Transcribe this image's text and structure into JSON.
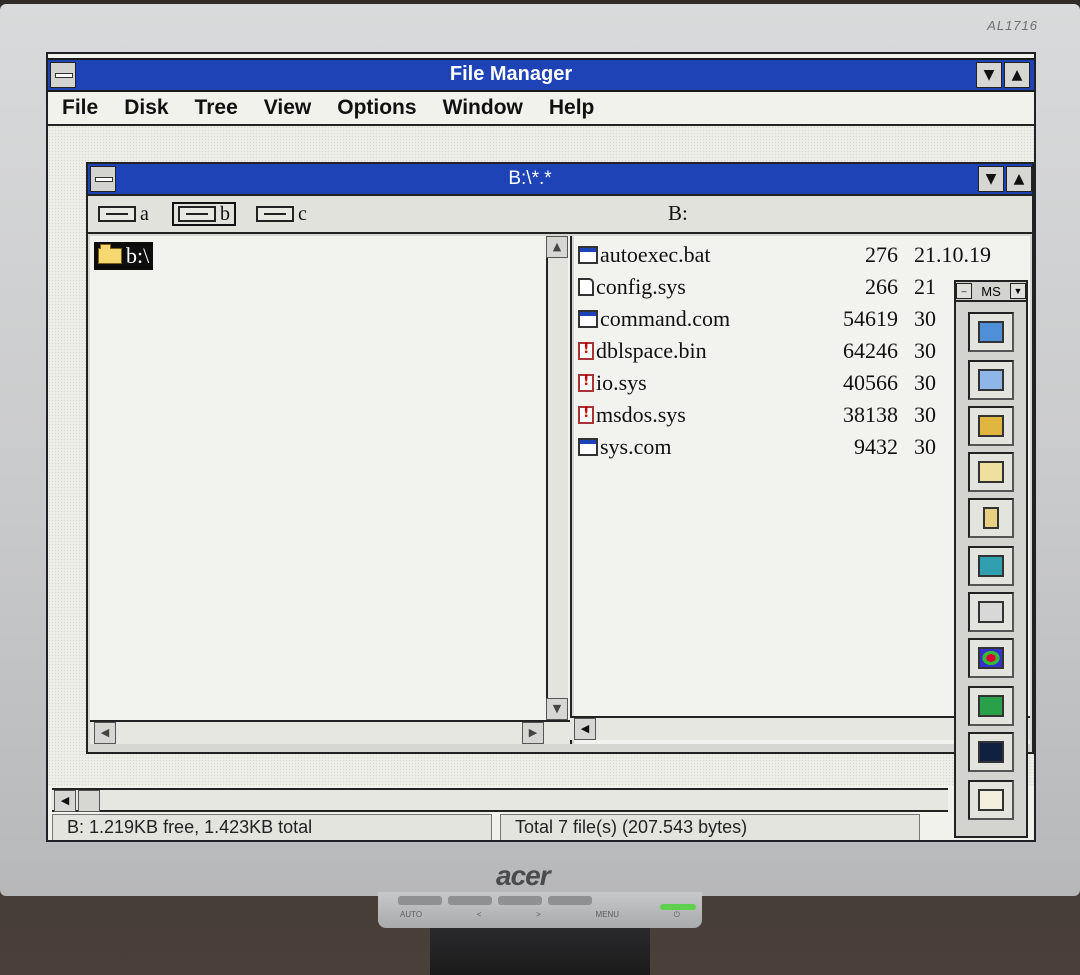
{
  "monitor": {
    "model": "AL1716",
    "brand": "acer",
    "buttons": [
      "AUTO",
      "<",
      ">",
      "MENU",
      "⏻"
    ]
  },
  "app": {
    "title": "File Manager",
    "menu": [
      {
        "label": "File"
      },
      {
        "label": "Disk"
      },
      {
        "label": "Tree"
      },
      {
        "label": "View"
      },
      {
        "label": "Options"
      },
      {
        "label": "Window"
      },
      {
        "label": "Help"
      }
    ]
  },
  "child_window": {
    "title": "B:\\*.*",
    "current_drive_label": "B:",
    "drives": [
      {
        "letter": "a",
        "selected": false
      },
      {
        "letter": "b",
        "selected": true
      },
      {
        "letter": "c",
        "selected": false
      }
    ],
    "tree_root": "b:\\"
  },
  "files": [
    {
      "name": "autoexec.bat",
      "size": "276",
      "date": "21.10.19",
      "icon": "program-file-icon"
    },
    {
      "name": "config.sys",
      "size": "266",
      "date": "21",
      "icon": "document-file-icon"
    },
    {
      "name": "command.com",
      "size": "54619",
      "date": "30",
      "icon": "program-file-icon"
    },
    {
      "name": "dblspace.bin",
      "size": "64246",
      "date": "30",
      "icon": "system-file-icon"
    },
    {
      "name": "io.sys",
      "size": "40566",
      "date": "30",
      "icon": "system-file-icon"
    },
    {
      "name": "msdos.sys",
      "size": "38138",
      "date": "30",
      "icon": "system-file-icon"
    },
    {
      "name": "sys.com",
      "size": "9432",
      "date": "30",
      "icon": "program-file-icon"
    }
  ],
  "ms_toolbar": {
    "title": "MS",
    "apps": [
      "excel-icon",
      "word-icon",
      "keys-icon",
      "mail-icon",
      "cabinet-icon",
      "calculator-icon",
      "control-panel-icon",
      "paint-icon",
      "write-icon",
      "screensaver-icon",
      "notes-icon"
    ]
  },
  "status": {
    "free": "B: 1.219KB free, 1.423KB total",
    "total": "Total 7 file(s) (207.543 bytes)"
  },
  "colors": {
    "titlebar": "#1d43b6",
    "screen_bg": "#f1f2ec"
  }
}
